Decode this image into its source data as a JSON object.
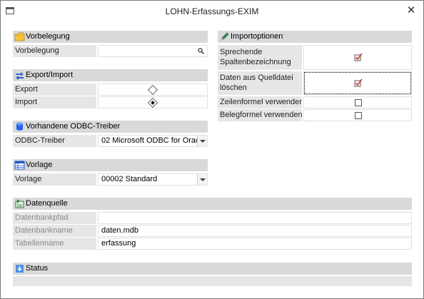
{
  "window": {
    "title": "LOHN-Erfassungs-EXIM",
    "close_glyph": "✕"
  },
  "vorbelegung": {
    "header": "Vorbelegung",
    "icon": "folder-icon",
    "label": "Vorbelegung",
    "value": "",
    "lookup_icon": "magnifier-icon"
  },
  "export_import": {
    "header": "Export/Import",
    "icon": "transfer-arrows-icon",
    "export_label": "Export",
    "import_label": "Import",
    "export_selected": false,
    "import_selected": true
  },
  "odbc": {
    "header": "Vorhandene ODBC-Treiber",
    "icon": "database-icon",
    "label": "ODBC-Treiber",
    "value": "02 Microsoft ODBC for Orac"
  },
  "vorlage": {
    "header": "Vorlage",
    "icon": "table-icon",
    "label": "Vorlage",
    "value": "00002 Standard"
  },
  "datenquelle": {
    "header": "Datenquelle",
    "icon": "datasource-icon",
    "rows": [
      {
        "label": "Datenbankpfad",
        "value": ""
      },
      {
        "label": "Datenbankname",
        "value": "daten.mdb"
      },
      {
        "label": "Tabellenname",
        "value": "erfassung"
      }
    ]
  },
  "status": {
    "header": "Status",
    "icon": "status-arrow-icon"
  },
  "importoptionen": {
    "header": "Importoptionen",
    "icon": "pencil-icon",
    "options": [
      {
        "label": "Sprechende Spaltenbezeichnung",
        "checked": true
      },
      {
        "label": "Daten aus Quelldatei löschen",
        "checked": true
      },
      {
        "label": "Zeilenformel verwenden",
        "checked": false
      },
      {
        "label": "Belegformel verwenden",
        "checked": false
      }
    ]
  },
  "colors": {
    "header_bg": "#d9d9d9",
    "label_bg": "#e6e6e6",
    "check_color": "#c0392b"
  }
}
